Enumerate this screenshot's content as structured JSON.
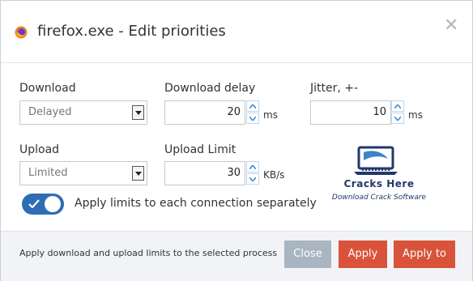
{
  "dialog": {
    "title": "firefox.exe - Edit priorities",
    "app_icon": "firefox-icon",
    "close_glyph": "✕"
  },
  "download": {
    "label": "Download",
    "selected": "Delayed"
  },
  "download_delay": {
    "label": "Download delay",
    "value": "20",
    "unit": "ms"
  },
  "jitter": {
    "label": "Jitter, +-",
    "value": "10",
    "unit": "ms"
  },
  "upload": {
    "label": "Upload",
    "selected": "Limited"
  },
  "upload_limit": {
    "label": "Upload Limit",
    "value": "30",
    "unit": "KB/s"
  },
  "apply_separately": {
    "label": "Apply limits to each connection separately",
    "enabled": true
  },
  "logo": {
    "line1": "Cracks Here",
    "line2": "Download Crack Software",
    "icon": "monitor-icon"
  },
  "footer": {
    "hint": "Apply download and upload limits to the selected process",
    "close_label": "Close",
    "apply_label": "Apply",
    "apply_to_label": "Apply to"
  },
  "colors": {
    "accent": "#2e6db4",
    "danger": "#d9533a",
    "disabled": "#a9b6c1"
  }
}
